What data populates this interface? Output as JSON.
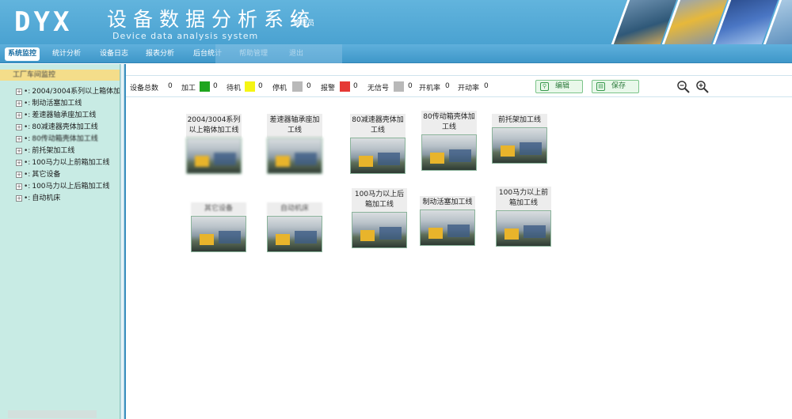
{
  "header": {
    "logo": "DYX",
    "title": "设备数据分析系统",
    "user_label": "管理员",
    "subtitle": "Device data analysis system"
  },
  "nav": {
    "tabs": [
      {
        "label": "系统监控",
        "active": true
      },
      {
        "label": "统计分析",
        "active": false
      },
      {
        "label": "设备日志",
        "active": false
      },
      {
        "label": "报表分析",
        "active": false
      },
      {
        "label": "后台统计",
        "active": false
      },
      {
        "label": "帮助管理",
        "active": false
      },
      {
        "label": "退出",
        "active": false
      }
    ]
  },
  "sidebar": {
    "root_label": "工厂车间监控",
    "items": [
      {
        "label": "2004/3004系列以上箱体加"
      },
      {
        "label": "制动活塞加工线"
      },
      {
        "label": "差速器轴承座加工线"
      },
      {
        "label": "80减速器壳体加工线"
      },
      {
        "label": "80传动箱壳体加工线"
      },
      {
        "label": "前托架加工线"
      },
      {
        "label": "100马力以上前箱加工线"
      },
      {
        "label": "其它设备"
      },
      {
        "label": "100马力以上后箱加工线"
      },
      {
        "label": "自动机床"
      }
    ]
  },
  "toolbar": {
    "total_label": "设备总数",
    "total_value": "0",
    "processing_label": "加工",
    "processing_value": "0",
    "standby_label": "待机",
    "standby_value": "0",
    "shutdown_label": "停机",
    "shutdown_value": "0",
    "alarm_label": "报警",
    "alarm_value": "0",
    "nosignal_label": "无信号",
    "nosignal_value": "0",
    "poweron_label": "开机率",
    "poweron_value": "0",
    "operating_label": "开动率",
    "operating_value": "0",
    "edit_label": "编辑",
    "save_label": "保存",
    "colors": {
      "processing": "#1fa51f",
      "standby": "#f5f513",
      "shutdown": "#b9b9b9",
      "alarm": "#e53935",
      "nosignal": "#b9b9b9"
    }
  },
  "machines": [
    {
      "label": "2004/3004系列以上箱体加工线"
    },
    {
      "label": "差速器轴承座加工线"
    },
    {
      "label": "80减速器壳体加工线"
    },
    {
      "label": "80传动箱壳体加工线"
    },
    {
      "label": "前托架加工线"
    },
    {
      "label": "其它设备"
    },
    {
      "label": "自动机床"
    },
    {
      "label": "100马力以上后箱加工线"
    },
    {
      "label": "制动活塞加工线"
    },
    {
      "label": "100马力以上前箱加工线"
    }
  ]
}
